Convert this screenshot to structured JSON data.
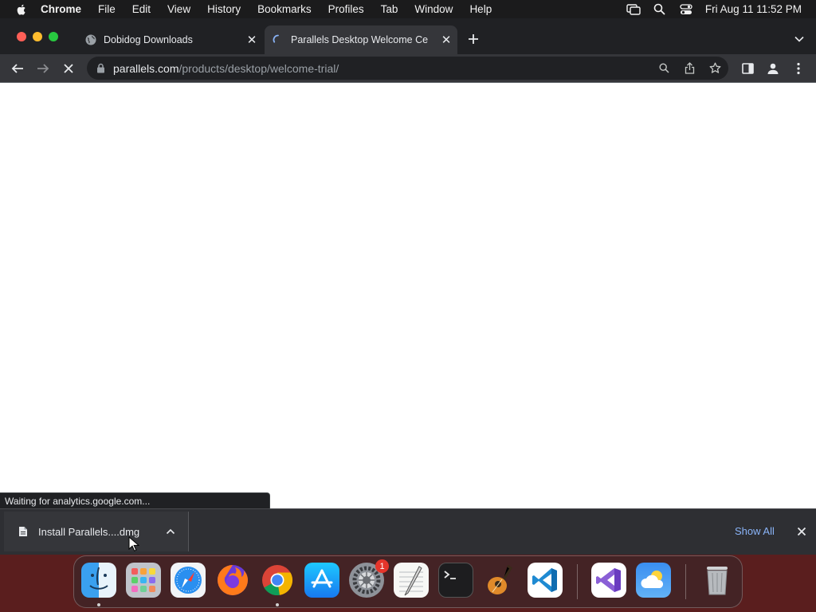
{
  "menubar": {
    "app_name": "Chrome",
    "items": [
      "File",
      "Edit",
      "View",
      "History",
      "Bookmarks",
      "Profiles",
      "Tab",
      "Window",
      "Help"
    ],
    "clock": "Fri Aug 11  11:52 PM"
  },
  "tabs": [
    {
      "title": "Dobidog Downloads",
      "active": false
    },
    {
      "title": "Parallels Desktop Welcome Ce",
      "active": true
    }
  ],
  "omnibox": {
    "host": "parallels.com",
    "path": "/products/desktop/welcome-trial/"
  },
  "status_bubble": "Waiting for analytics.google.com...",
  "download_shelf": {
    "item_name": "Install Parallels....dmg",
    "show_all_label": "Show All"
  },
  "dock": {
    "apps": [
      "Finder",
      "Launchpad",
      "Safari",
      "Firefox",
      "Google Chrome",
      "App Store",
      "System Settings",
      "TextEdit",
      "Terminal",
      "GarageBand",
      "Visual Studio Code",
      "Visual Studio",
      "Weather",
      "Trash"
    ],
    "settings_badge": "1"
  },
  "colors": {
    "chrome_dark": "#202124",
    "toolbar": "#35363a",
    "link_blue": "#8ab4f8",
    "badge_red": "#e5352b"
  }
}
